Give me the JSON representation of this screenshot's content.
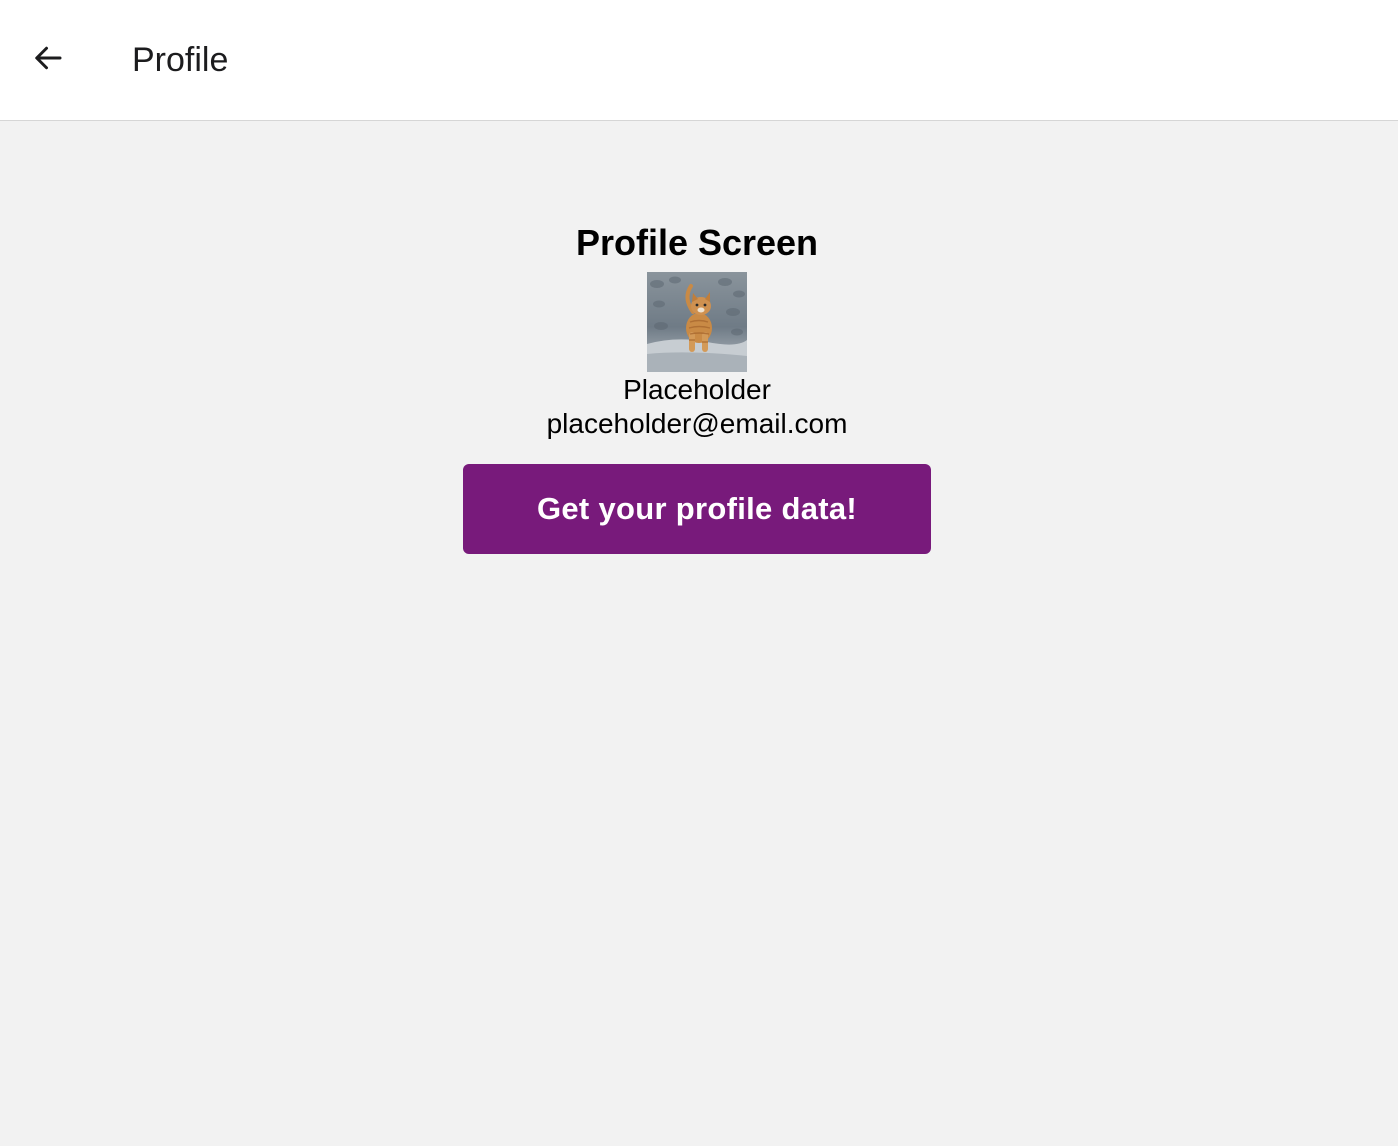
{
  "header": {
    "title": "Profile",
    "back_icon": "arrow-left-icon"
  },
  "main": {
    "heading": "Profile Screen",
    "avatar": {
      "icon": "kitten-photo",
      "bg": "#7d8a96",
      "cat": "#c98a45"
    },
    "name": "Placeholder",
    "email": "placeholder@email.com",
    "button_label": "Get your profile data!"
  },
  "colors": {
    "background": "#f2f2f2",
    "header_bg": "#ffffff",
    "button_bg": "#781a7b",
    "button_text": "#ffffff"
  }
}
